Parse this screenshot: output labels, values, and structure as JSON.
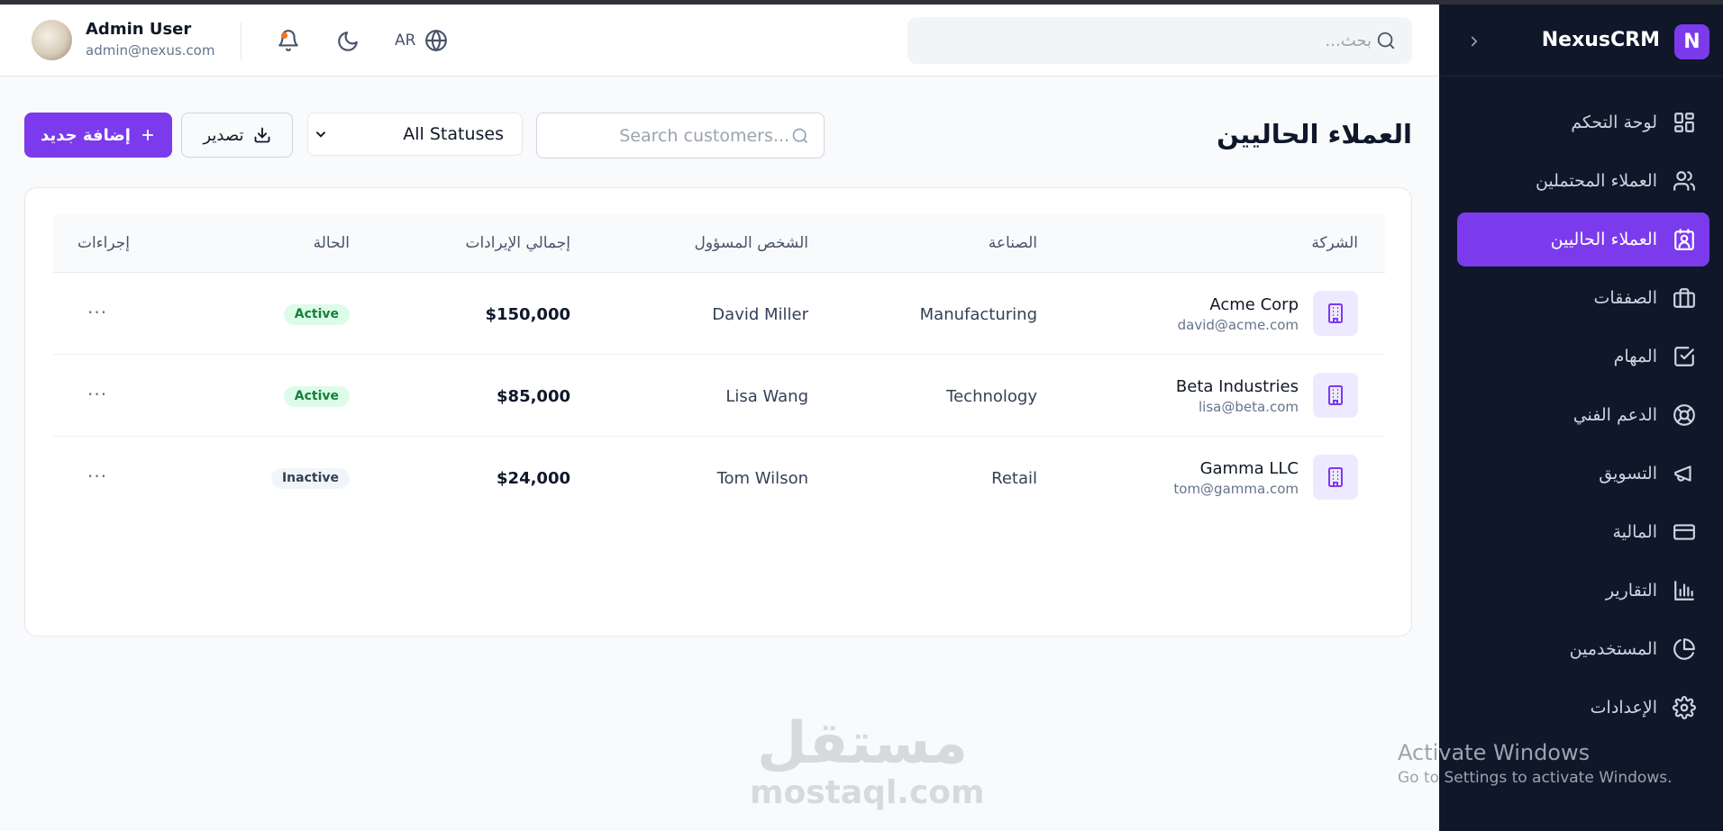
{
  "app": {
    "brand": "NexusCRM",
    "logo_letter": "N"
  },
  "header": {
    "user_name": "Admin User",
    "user_email": "admin@nexus.com",
    "language": "AR",
    "search_placeholder": "بحث..."
  },
  "sidebar": {
    "items": [
      {
        "label": "لوحة التحكم",
        "icon": "dashboard-icon"
      },
      {
        "label": "العملاء المحتملين",
        "icon": "users-icon"
      },
      {
        "label": "العملاء الحاليين",
        "icon": "contact-icon",
        "active": true
      },
      {
        "label": "الصفقات",
        "icon": "briefcase-icon"
      },
      {
        "label": "المهام",
        "icon": "task-check-icon"
      },
      {
        "label": "الدعم الفني",
        "icon": "lifebuoy-icon"
      },
      {
        "label": "التسويق",
        "icon": "megaphone-icon"
      },
      {
        "label": "المالية",
        "icon": "credit-card-icon"
      },
      {
        "label": "التقارير",
        "icon": "bar-chart-icon"
      },
      {
        "label": "المستخدمين",
        "icon": "pie-chart-icon"
      },
      {
        "label": "الإعدادات",
        "icon": "gear-icon"
      }
    ]
  },
  "page": {
    "title": "العملاء الحاليين",
    "search_placeholder": "Search customers...",
    "status_filter": "All Statuses",
    "export_label": "تصدير",
    "add_label": "إضافة جديد"
  },
  "table": {
    "headers": {
      "company": "الشركة",
      "industry": "الصناعة",
      "contact": "الشخص المسؤول",
      "revenue": "إجمالي الإيرادات",
      "status": "الحالة",
      "actions": "إجراءات"
    },
    "rows": [
      {
        "company": "Acme Corp",
        "email": "david@acme.com",
        "industry": "Manufacturing",
        "contact": "David Miller",
        "revenue": "$150,000",
        "status": "Active"
      },
      {
        "company": "Beta Industries",
        "email": "lisa@beta.com",
        "industry": "Technology",
        "contact": "Lisa Wang",
        "revenue": "$85,000",
        "status": "Active"
      },
      {
        "company": "Gamma LLC",
        "email": "tom@gamma.com",
        "industry": "Retail",
        "contact": "Tom Wilson",
        "revenue": "$24,000",
        "status": "Inactive"
      }
    ],
    "actions_glyph": "···"
  },
  "watermark": {
    "arabic": "مستقل",
    "latin": "mostaql.com"
  },
  "os_overlay": {
    "title": "Activate Windows",
    "subtitle": "Go to Settings to activate Windows."
  },
  "colors": {
    "accent": "#7c3aed",
    "sidebar_bg": "#0f1729",
    "active_badge": "#15803d"
  }
}
